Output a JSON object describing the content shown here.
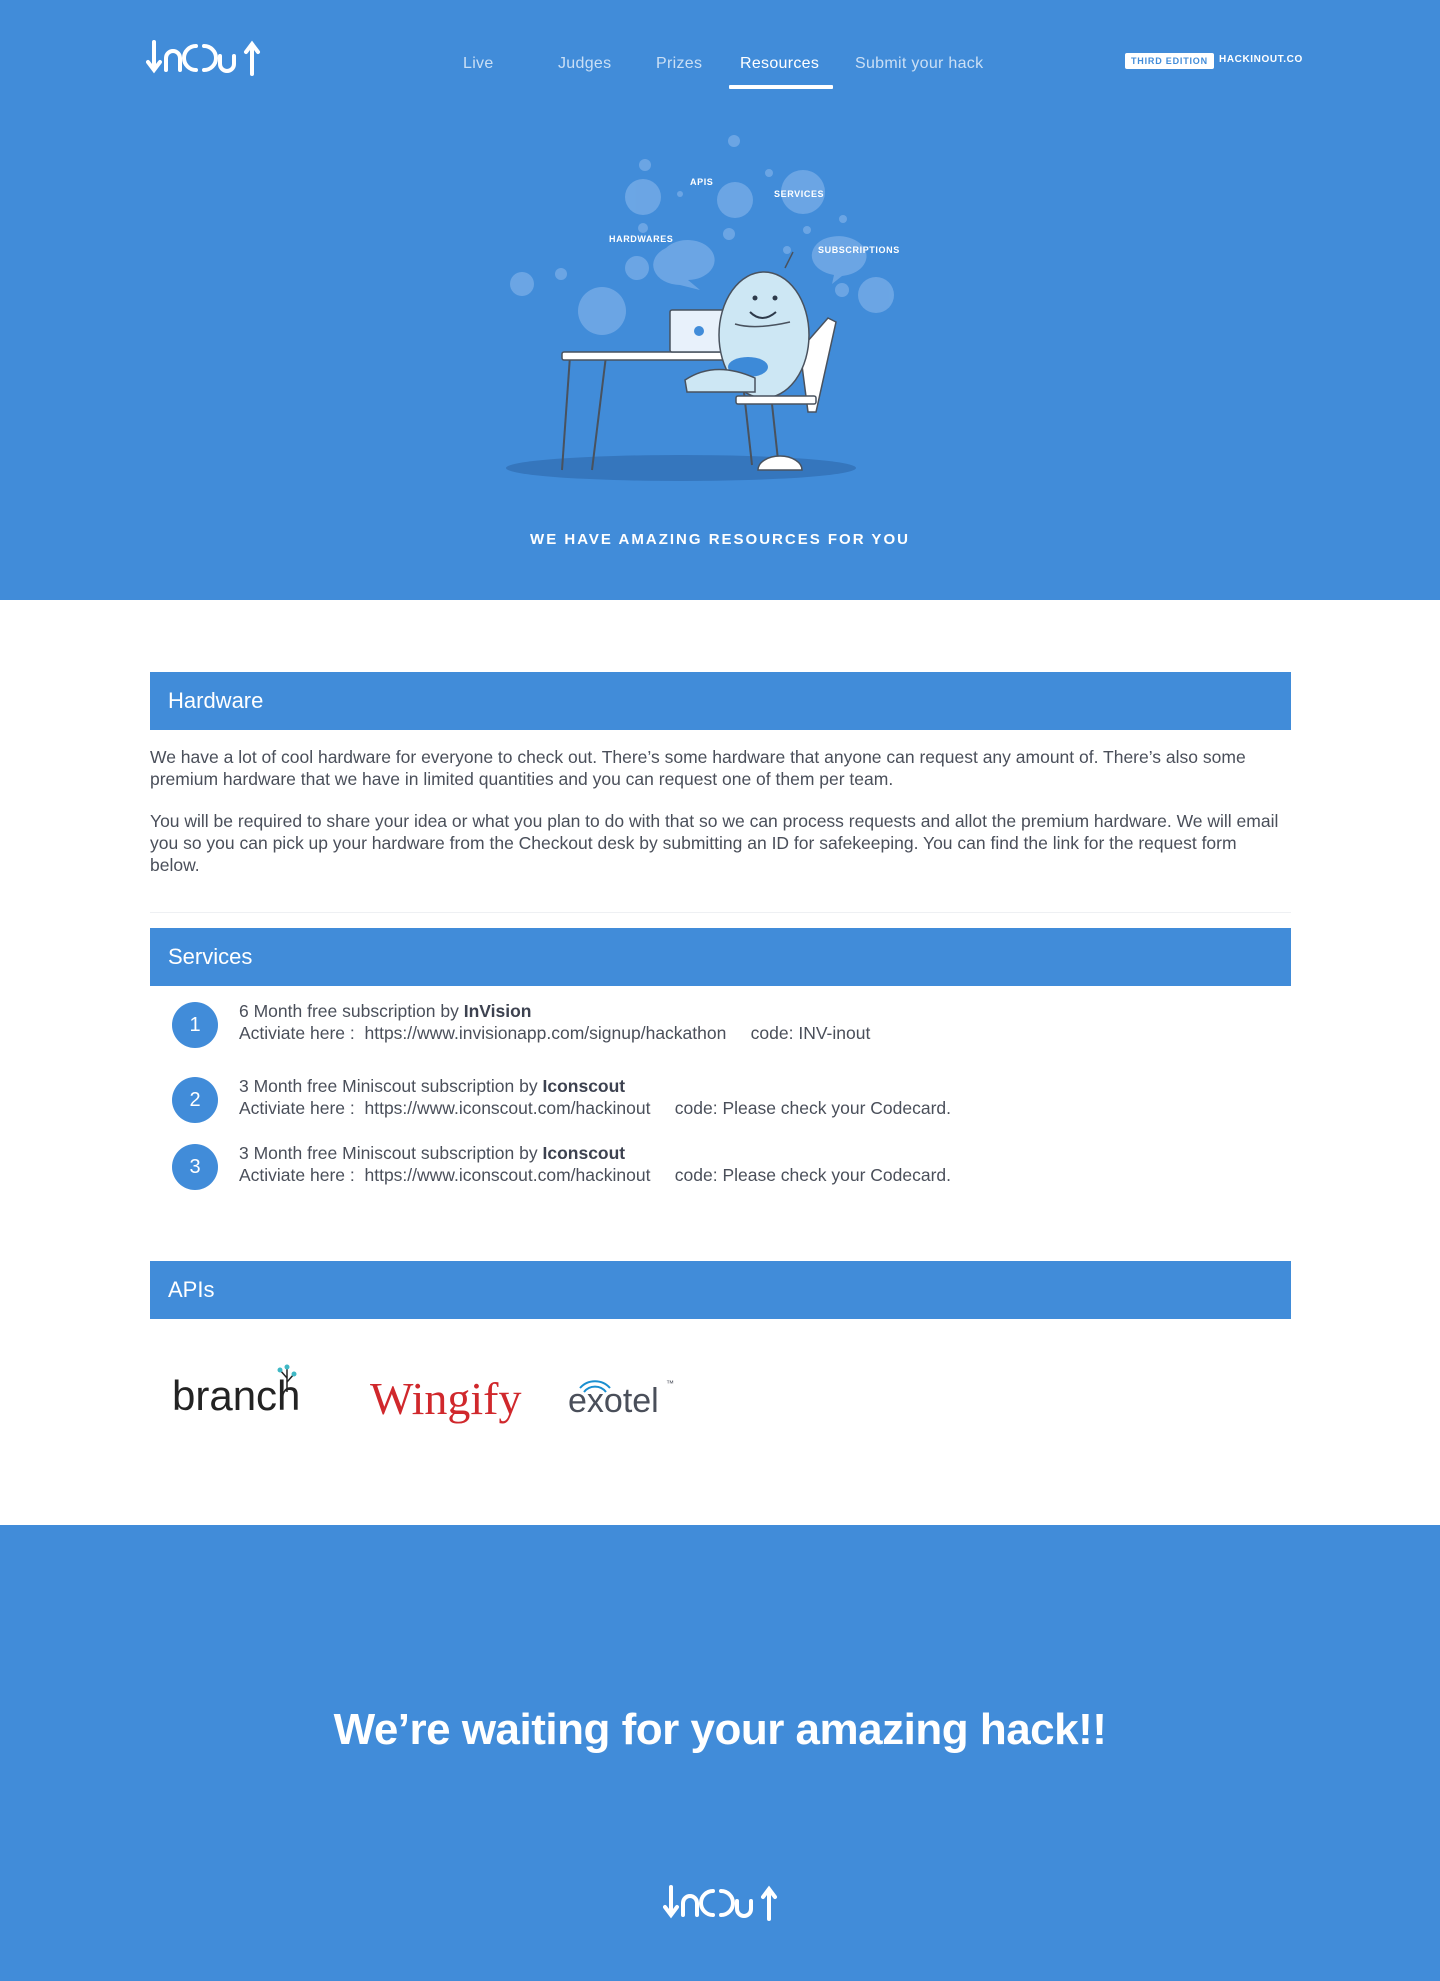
{
  "nav": {
    "items": [
      {
        "label": "Live"
      },
      {
        "label": "Judges"
      },
      {
        "label": "Prizes"
      },
      {
        "label": "Resources"
      },
      {
        "label": "Submit your hack"
      }
    ],
    "active": "Resources"
  },
  "header": {
    "logo_text": "InOut",
    "edition_badge": "THIRD EDITION",
    "site_link": "HACKINOUT.CO"
  },
  "hero": {
    "bubbles": {
      "apis": "APIS",
      "services": "SERVICES",
      "hardwares": "HARDWARES",
      "subscriptions": "SUBSCRIPTIONS"
    },
    "tagline": "WE HAVE AMAZING RESOURCES FOR YOU"
  },
  "hardware": {
    "title": "Hardware",
    "paragraphs": [
      "We have a lot of cool hardware for everyone to check out. There’s some hardware that anyone can request any amount of. There’s also some premium hardware that we have in limited quantities and you can request one of them per team.",
      "You will be required to share your idea or what you plan to do with that so we can process requests and allot the premium hardware. We will email you so you can pick up your hardware from the Checkout desk by submitting an ID for safekeeping. You can find the link for the request form below."
    ]
  },
  "services": {
    "title": "Services",
    "items": [
      {
        "number": "1",
        "offer": "6 Month free subscription by ",
        "brand": "InVision",
        "activate_label": "Activiate here :",
        "url": "https://www.invisionapp.com/signup/hackathon",
        "code": "code: INV-inout"
      },
      {
        "number": "2",
        "offer": "3 Month free Miniscout subscription by ",
        "brand": "Iconscout",
        "activate_label": "Activiate here :",
        "url": "https://www.iconscout.com/hackinout",
        "code": "code: Please check your Codecard."
      },
      {
        "number": "3",
        "offer": "3 Month free Miniscout subscription by ",
        "brand": "Iconscout",
        "activate_label": "Activiate here :",
        "url": "https://www.iconscout.com/hackinout",
        "code": "code: Please check your Codecard."
      }
    ]
  },
  "apis": {
    "title": "APIs",
    "logos": [
      "branch",
      "Wingify",
      "exotel"
    ],
    "exotel_tm": "™"
  },
  "footer": {
    "title": "We’re waiting for your amazing hack!!",
    "logo_text": "InOut"
  },
  "colors": {
    "brand_blue": "#418cd9",
    "text": "#4a4f5a",
    "wingify_red": "#d0282c",
    "branch_dark": "#232323",
    "exotel_blue": "#1a8fd0"
  }
}
